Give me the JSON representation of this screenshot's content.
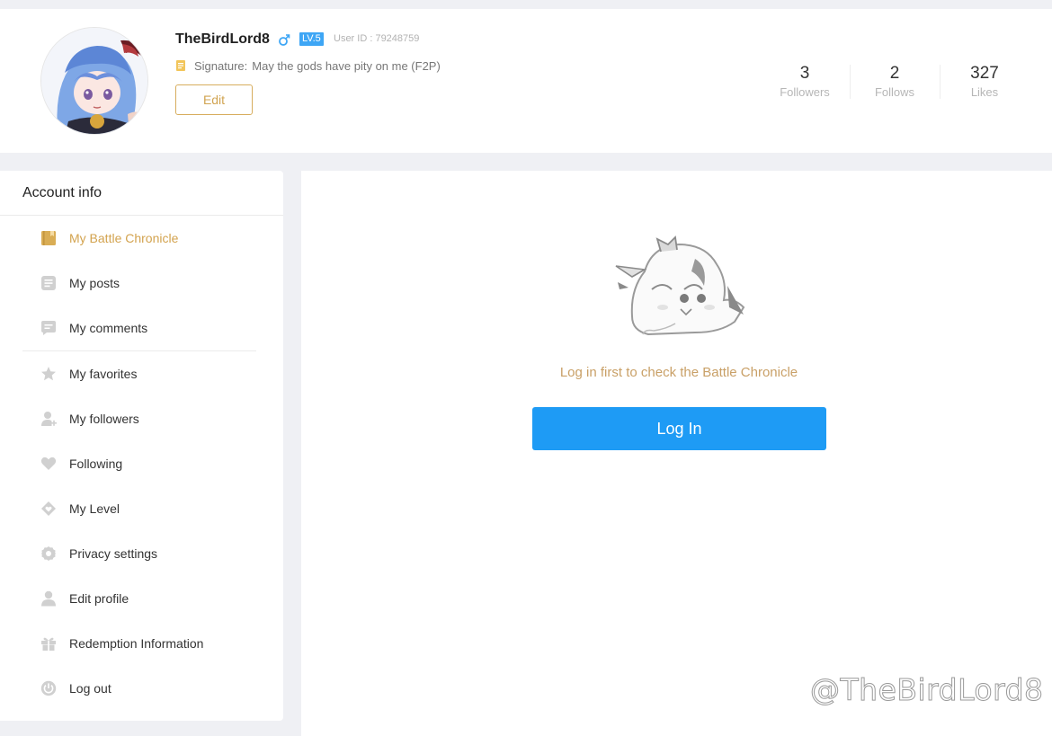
{
  "profile": {
    "username": "TheBirdLord8",
    "level": "LV.5",
    "user_id": "User ID : 79248759",
    "signature_label": "Signature:",
    "signature": "May the gods have pity on me (F2P)",
    "edit_label": "Edit",
    "gender_icon": "male-icon",
    "accent_color": "#d1a451",
    "level_color": "#3ea6f5"
  },
  "stats": [
    {
      "value": "3",
      "label": "Followers"
    },
    {
      "value": "2",
      "label": "Follows"
    },
    {
      "value": "327",
      "label": "Likes"
    }
  ],
  "sidebar": {
    "title": "Account info",
    "items": [
      {
        "label": "My Battle Chronicle",
        "icon": "book-icon",
        "active": true
      },
      {
        "label": "My posts",
        "icon": "posts-icon"
      },
      {
        "label": "My comments",
        "icon": "comment-icon"
      },
      {
        "label": "My favorites",
        "icon": "star-icon"
      },
      {
        "label": "My followers",
        "icon": "user-plus-icon"
      },
      {
        "label": "Following",
        "icon": "heart-icon"
      },
      {
        "label": "My Level",
        "icon": "diamond-heart-icon"
      },
      {
        "label": "Privacy settings",
        "icon": "gear-icon"
      },
      {
        "label": "Edit profile",
        "icon": "user-icon"
      },
      {
        "label": "Redemption Information",
        "icon": "gift-icon"
      },
      {
        "label": "Log out",
        "icon": "power-icon"
      }
    ]
  },
  "main": {
    "message": "Log in first to check the Battle Chronicle",
    "login_label": "Log In",
    "button_color": "#1e9bf5"
  },
  "watermark": "@TheBirdLord8"
}
